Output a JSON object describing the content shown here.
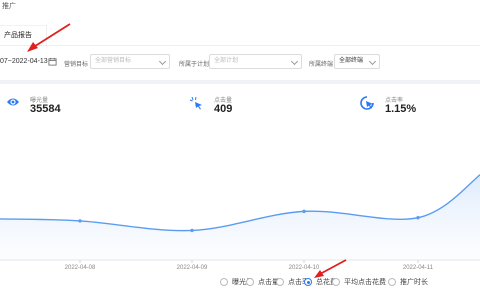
{
  "breadcrumb": "推广",
  "report_tab": "产品报告",
  "filters": {
    "date_range": "07~2022-04-13",
    "campaign_label": "营销目标",
    "campaign_placeholder": "全部营销目标",
    "plan_label": "所属于计划",
    "plan_placeholder": "全部计划",
    "terminal_label": "所属终端",
    "terminal_value": "全部终端"
  },
  "metrics": [
    {
      "label": "曝光量",
      "value": "35584",
      "icon": "eye-icon"
    },
    {
      "label": "点击量",
      "value": "409",
      "icon": "click-icon"
    },
    {
      "label": "点击率",
      "value": "1.15%",
      "icon": "cursor-icon"
    }
  ],
  "chart_data": {
    "type": "line",
    "x": [
      "2022-04-08",
      "2022-04-09",
      "2022-04-10",
      "2022-04-11"
    ],
    "series": [
      {
        "values": [
          12,
          6,
          18,
          14,
          42
        ]
      }
    ],
    "colors": {
      "line": "#5b9cf2",
      "fill": "#eaf2fd"
    }
  },
  "legend": [
    {
      "label": "曝光量",
      "selected": false
    },
    {
      "label": "点击量",
      "selected": false
    },
    {
      "label": "点击率",
      "selected": false
    },
    {
      "label": "总花费",
      "selected": true
    },
    {
      "label": "平均点击花费",
      "selected": false
    },
    {
      "label": "推广时长",
      "selected": false
    }
  ],
  "accent_color": "#2d78f4",
  "annotation_color": "#e02020"
}
